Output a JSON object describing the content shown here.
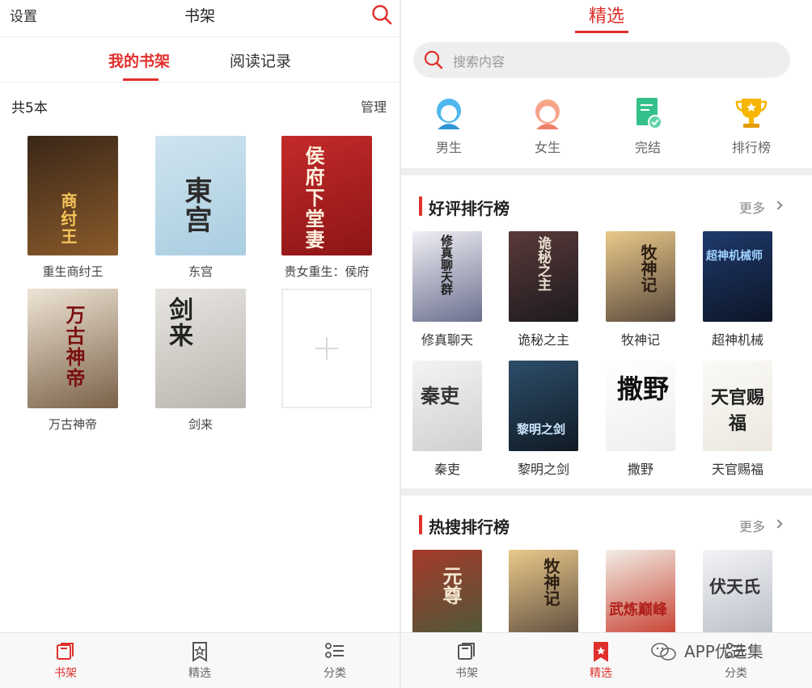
{
  "left": {
    "header": {
      "settings_label": "设置",
      "title": "书架"
    },
    "tabs": [
      {
        "label": "我的书架",
        "active": true
      },
      {
        "label": "阅读记录",
        "active": false
      }
    ],
    "summary": {
      "count_label": "共5本",
      "manage_label": "管理"
    },
    "books": [
      {
        "name": "重生商纣王",
        "cover_text": "商纣王",
        "colors": [
          "#3a2718",
          "#8a5a2a"
        ]
      },
      {
        "name": "东宫",
        "cover_text": "東宫",
        "colors": [
          "#cfe4ef",
          "#a9cde0"
        ]
      },
      {
        "name": "贵女重生：侯府",
        "cover_text": "侯府下堂妻",
        "colors": [
          "#c42a2a",
          "#8c1515"
        ]
      },
      {
        "name": "万古神帝",
        "cover_text": "万古神帝",
        "colors": [
          "#efe5d6",
          "#7a6148"
        ]
      },
      {
        "name": "剑来",
        "cover_text": "剑来",
        "colors": [
          "#e8e6e2",
          "#b9b5ae"
        ]
      }
    ],
    "bottom_nav": [
      {
        "label": "书架",
        "icon": "bookshelf-icon",
        "active": true
      },
      {
        "label": "精选",
        "icon": "bookmark-star-icon",
        "active": false
      },
      {
        "label": "分类",
        "icon": "list-category-icon",
        "active": false
      }
    ]
  },
  "right": {
    "header": {
      "title": "精选"
    },
    "search": {
      "placeholder": "搜索内容"
    },
    "categories": [
      {
        "label": "男生",
        "icon": "male-avatar-icon"
      },
      {
        "label": "女生",
        "icon": "female-avatar-icon"
      },
      {
        "label": "完结",
        "icon": "completed-book-icon"
      },
      {
        "label": "排行榜",
        "icon": "trophy-icon"
      }
    ],
    "sections": [
      {
        "title": "好评排行榜",
        "more_label": "更多",
        "books": [
          {
            "name": "修真聊天",
            "cover_text": "修真聊天群",
            "colors": [
              "#f0f0f5",
              "#6b6f8e"
            ]
          },
          {
            "name": "诡秘之主",
            "cover_text": "诡秘之主",
            "colors": [
              "#5a3a3a",
              "#1d1a1e"
            ]
          },
          {
            "name": "牧神记",
            "cover_text": "牧神记",
            "colors": [
              "#e9c98a",
              "#5b4a3d"
            ]
          },
          {
            "name": "超神机械",
            "cover_text": "超神机械师",
            "colors": [
              "#1f3a6b",
              "#0c1527"
            ]
          },
          {
            "name": "秦吏",
            "cover_text": "秦吏",
            "colors": [
              "#f4f4f4",
              "#cfcfcf"
            ]
          },
          {
            "name": "黎明之剑",
            "cover_text": "黎明之剑",
            "colors": [
              "#2d4e6a",
              "#101a24"
            ]
          },
          {
            "name": "撒野",
            "cover_text": "撒野",
            "colors": [
              "#ffffff",
              "#eeeeee"
            ]
          },
          {
            "name": "天官赐福",
            "cover_text": "天官赐福",
            "colors": [
              "#fbfaf7",
              "#ece8df"
            ]
          }
        ]
      },
      {
        "title": "热搜排行榜",
        "more_label": "更多",
        "books": [
          {
            "name": "",
            "cover_text": "元尊",
            "colors": [
              "#a53a2a",
              "#4a5a3a"
            ]
          },
          {
            "name": "",
            "cover_text": "牧神记",
            "colors": [
              "#e9c98a",
              "#5b4a3d"
            ]
          },
          {
            "name": "",
            "cover_text": "武炼巅峰",
            "colors": [
              "#f2eee6",
              "#c63a2a"
            ]
          },
          {
            "name": "",
            "cover_text": "伏天氏",
            "colors": [
              "#f3f4f6",
              "#b8bcc6"
            ]
          }
        ]
      }
    ],
    "bottom_nav": [
      {
        "label": "书架",
        "icon": "bookshelf-icon",
        "active": false
      },
      {
        "label": "精选",
        "icon": "bookmark-star-icon",
        "active": true
      },
      {
        "label": "分类",
        "icon": "list-category-icon",
        "active": false
      }
    ]
  },
  "watermark": {
    "text": "APP优选集"
  }
}
